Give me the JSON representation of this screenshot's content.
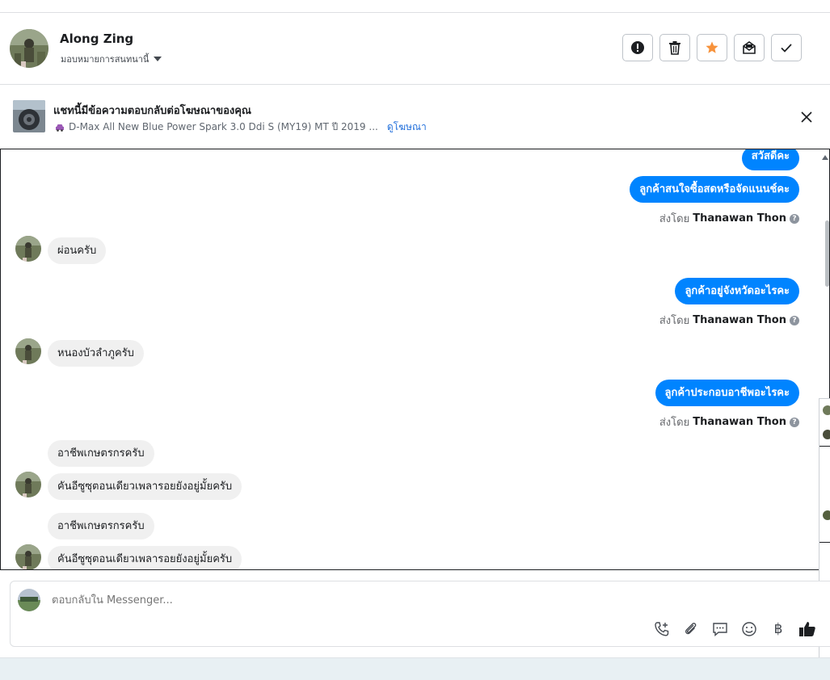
{
  "header": {
    "contact_name": "Along Zing",
    "assign_label": "มอบหมายการสนทนานี้",
    "actions": [
      {
        "name": "mark-spam-button",
        "icon": "exclamation-icon"
      },
      {
        "name": "delete-button",
        "icon": "trash-icon"
      },
      {
        "name": "star-button",
        "icon": "star-icon"
      },
      {
        "name": "mark-unread-button",
        "icon": "envelope-icon"
      },
      {
        "name": "mark-done-button",
        "icon": "check-icon"
      }
    ],
    "star_color": "#f7923b"
  },
  "ad": {
    "title": "แชทนี้มีข้อความตอบกลับต่อโฆษณาของคุณ",
    "vehicle_icon": "car-icon",
    "subtitle": "D-Max All New Blue Power Spark 3.0 Ddi S (MY19) MT ปี 2019 ...",
    "link": "ดูโฆษณา"
  },
  "messages": {
    "m1": "สวัสดีคะ",
    "m2": "ลูกค้าสนใจซื้อสดหรือจัดแนนช์คะ",
    "m3": "ผ่อนครับ",
    "m4": "ลูกค้าอยู่จังหวัดอะไรคะ",
    "m5": "หนองบัวลำภูครับ",
    "m6": "ลูกค้าประกอบอาชีพอะไรคะ",
    "m7": "อาชีพเกษตรกรครับ",
    "m8": "คันอีซูซุตอนเดียวเพลารอยยังอยู่มั้ยครับ",
    "m9": "อาชีพเกษตรกรครับ",
    "m10": "คันอีซูซุตอนเดียวเพลารอยยังอยู่มั้ยครับ"
  },
  "sent_by": {
    "prefix": "ส่งโดย",
    "agent": "Thanawan Thon",
    "help_glyph": "?"
  },
  "composer": {
    "placeholder": "ตอบกลับใน Messenger...",
    "tools": [
      "add-call-icon",
      "paperclip-icon",
      "saved-reply-icon",
      "emoji-icon",
      "baht-icon",
      "thumbs-up-icon"
    ],
    "baht_glyph": "฿"
  },
  "colors": {
    "outgoing_bubble": "#0084ff",
    "incoming_bubble": "#f0f0f0",
    "link": "#216fdb"
  }
}
